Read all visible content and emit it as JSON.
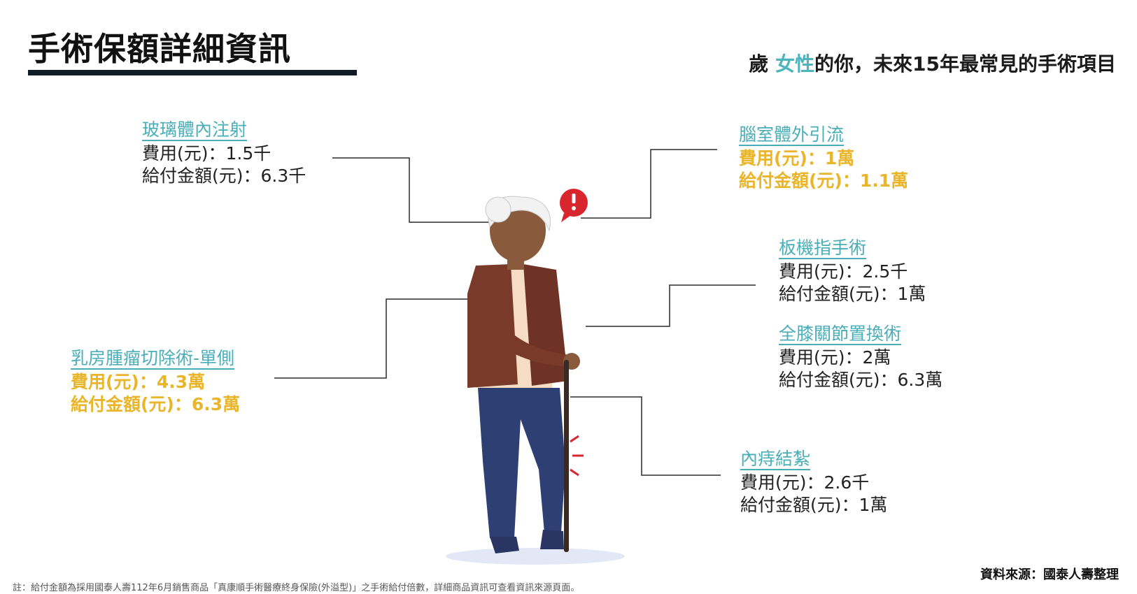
{
  "title": "手術保額詳細資訊",
  "subtitle": {
    "prefix": "歲 ",
    "highlight": "女性",
    "suffix": "的你，未來15年最常見的手術項目"
  },
  "procedures": [
    {
      "name": "玻璃體內注射",
      "cost": "費用(元)：1.5千",
      "payout": "給付金額(元)：6.3千"
    },
    {
      "name": "腦室體外引流",
      "cost": "費用(元)：1萬",
      "payout": "給付金額(元)：1.1萬"
    },
    {
      "name": "板機指手術",
      "cost": "費用(元)：2.5千",
      "payout": "給付金額(元)：1萬"
    },
    {
      "name": "全膝關節置換術",
      "cost": "費用(元)：2萬",
      "payout": "給付金額(元)：6.3萬"
    },
    {
      "name": "乳房腫瘤切除術-單側",
      "cost": "費用(元)：4.3萬",
      "payout": "給付金額(元)：6.3萬"
    },
    {
      "name": "內痔結紮",
      "cost": "費用(元)：2.6千",
      "payout": "給付金額(元)：1萬"
    }
  ],
  "alert_icon": "exclamation-bubble-icon",
  "colors": {
    "accent": "#4aaeb8",
    "warning": "#e9b52a",
    "dark": "#0f1b26"
  },
  "footnote": "註：給付金額為採用國泰人壽112年6月銷售商品「真康順手術醫療終身保險(外溢型)」之手術給付倍數，詳細商品資訊可查看資訊來源頁面。",
  "source": "資料來源：國泰人壽整理"
}
